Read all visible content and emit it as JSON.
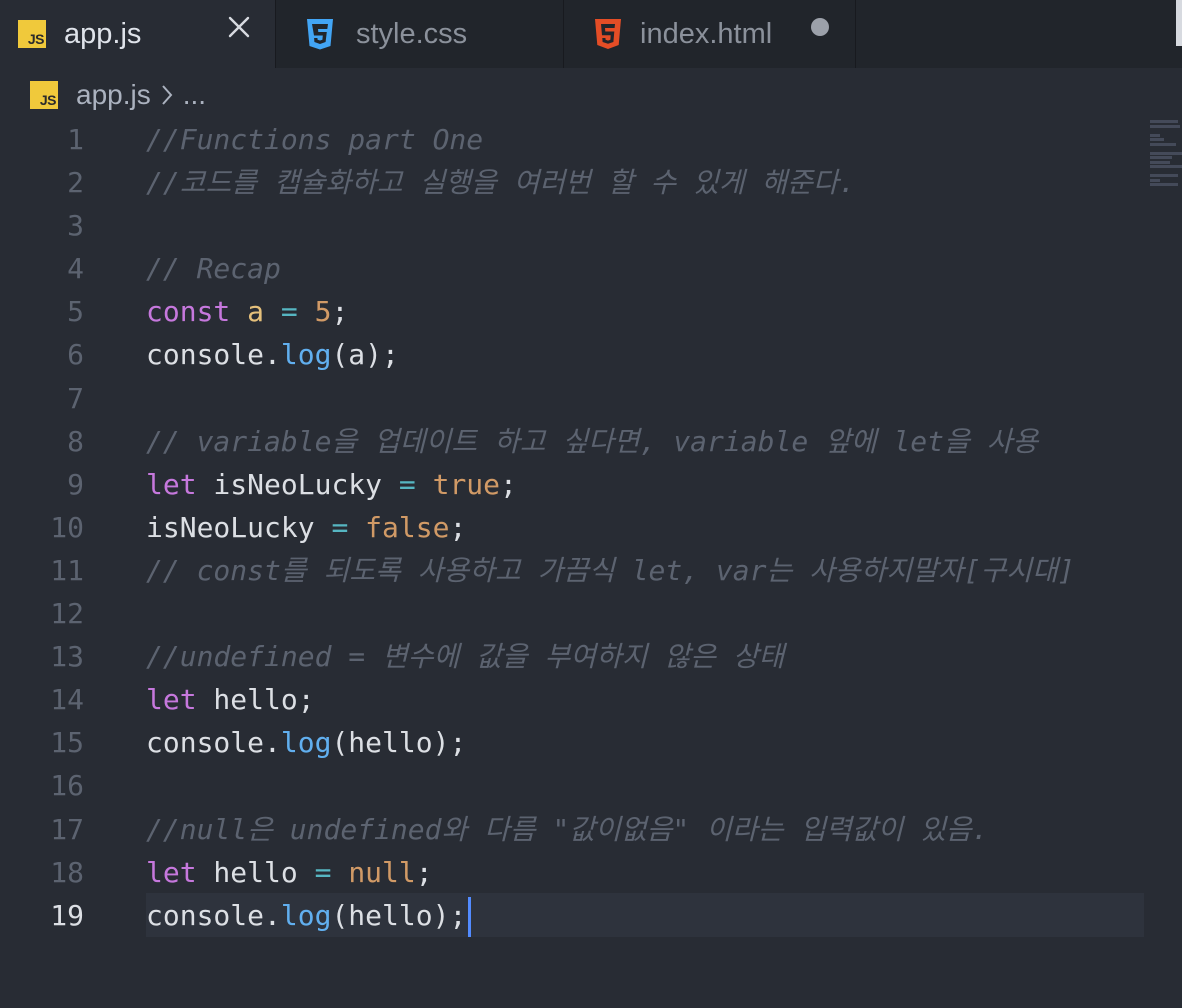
{
  "tabs": [
    {
      "label": "app.js",
      "icon": "js-file-icon",
      "active": true,
      "action": "close"
    },
    {
      "label": "style.css",
      "icon": "css3-file-icon",
      "active": false
    },
    {
      "label": "index.html",
      "icon": "html5-file-icon",
      "active": false,
      "unsaved": true
    }
  ],
  "breadcrumb": {
    "file": "app.js",
    "separator": ">",
    "more": "..."
  },
  "editor": {
    "current_line": 19,
    "lines": [
      {
        "n": "1",
        "tokens": [
          {
            "t": "//Functions part One",
            "c": "comment"
          }
        ]
      },
      {
        "n": "2",
        "tokens": [
          {
            "t": "//코드를 캡슐화하고 실행을 여러번 할 수 있게 해준다.",
            "c": "comment"
          }
        ]
      },
      {
        "n": "3",
        "tokens": []
      },
      {
        "n": "4",
        "tokens": [
          {
            "t": "// Recap",
            "c": "comment"
          }
        ]
      },
      {
        "n": "5",
        "tokens": [
          {
            "t": "const",
            "c": "keyword"
          },
          {
            "t": " ",
            "c": "plain"
          },
          {
            "t": "a",
            "c": "var"
          },
          {
            "t": " ",
            "c": "plain"
          },
          {
            "t": "=",
            "c": "op"
          },
          {
            "t": " ",
            "c": "plain"
          },
          {
            "t": "5",
            "c": "number"
          },
          {
            "t": ";",
            "c": "punct"
          }
        ]
      },
      {
        "n": "6",
        "tokens": [
          {
            "t": "console",
            "c": "plain"
          },
          {
            "t": ".",
            "c": "punct"
          },
          {
            "t": "log",
            "c": "fn"
          },
          {
            "t": "(a);",
            "c": "punct"
          }
        ]
      },
      {
        "n": "7",
        "tokens": []
      },
      {
        "n": "8",
        "tokens": [
          {
            "t": "// variable을 업데이트 하고 싶다면, variable 앞에 let을 사용",
            "c": "comment"
          }
        ]
      },
      {
        "n": "9",
        "tokens": [
          {
            "t": "let",
            "c": "keyword"
          },
          {
            "t": " isNeoLucky ",
            "c": "plain"
          },
          {
            "t": "=",
            "c": "op"
          },
          {
            "t": " ",
            "c": "plain"
          },
          {
            "t": "true",
            "c": "bool"
          },
          {
            "t": ";",
            "c": "punct"
          }
        ]
      },
      {
        "n": "10",
        "tokens": [
          {
            "t": "isNeoLucky ",
            "c": "plain"
          },
          {
            "t": "=",
            "c": "op"
          },
          {
            "t": " ",
            "c": "plain"
          },
          {
            "t": "false",
            "c": "bool"
          },
          {
            "t": ";",
            "c": "punct"
          }
        ]
      },
      {
        "n": "11",
        "tokens": [
          {
            "t": "// const를 되도록 사용하고 가끔식 let, var는 사용하지말자[구시대]",
            "c": "comment"
          }
        ]
      },
      {
        "n": "12",
        "tokens": []
      },
      {
        "n": "13",
        "tokens": [
          {
            "t": "//undefined = 변수에 값을 부여하지 않은 상태",
            "c": "comment"
          }
        ]
      },
      {
        "n": "14",
        "tokens": [
          {
            "t": "let",
            "c": "keyword"
          },
          {
            "t": " hello;",
            "c": "plain"
          }
        ]
      },
      {
        "n": "15",
        "tokens": [
          {
            "t": "console",
            "c": "plain"
          },
          {
            "t": ".",
            "c": "punct"
          },
          {
            "t": "log",
            "c": "fn"
          },
          {
            "t": "(hello);",
            "c": "punct"
          }
        ]
      },
      {
        "n": "16",
        "tokens": []
      },
      {
        "n": "17",
        "tokens": [
          {
            "t": "//null은 undefined와 다름 \"값이없음\" 이라는 입력값이 있음.",
            "c": "comment"
          }
        ]
      },
      {
        "n": "18",
        "tokens": [
          {
            "t": "let",
            "c": "keyword"
          },
          {
            "t": " hello ",
            "c": "plain"
          },
          {
            "t": "=",
            "c": "op"
          },
          {
            "t": " ",
            "c": "plain"
          },
          {
            "t": "null",
            "c": "bool"
          },
          {
            "t": ";",
            "c": "punct"
          }
        ]
      },
      {
        "n": "19",
        "tokens": [
          {
            "t": "console",
            "c": "plain"
          },
          {
            "t": ".",
            "c": "punct"
          },
          {
            "t": "log",
            "c": "fn"
          },
          {
            "t": "(hello);",
            "c": "punct"
          }
        ]
      }
    ]
  },
  "colors": {
    "background": "#282c34",
    "tab_bar": "#21252b",
    "comment": "#5c6370",
    "keyword": "#c678dd",
    "function": "#61afef",
    "operator": "#56b6c2",
    "literal": "#d19a66",
    "variable": "#e5c07b",
    "cursor": "#528bff",
    "js_badge": "#f0c93b",
    "css_badge": "#42a5f5",
    "html_badge": "#e44d26"
  }
}
